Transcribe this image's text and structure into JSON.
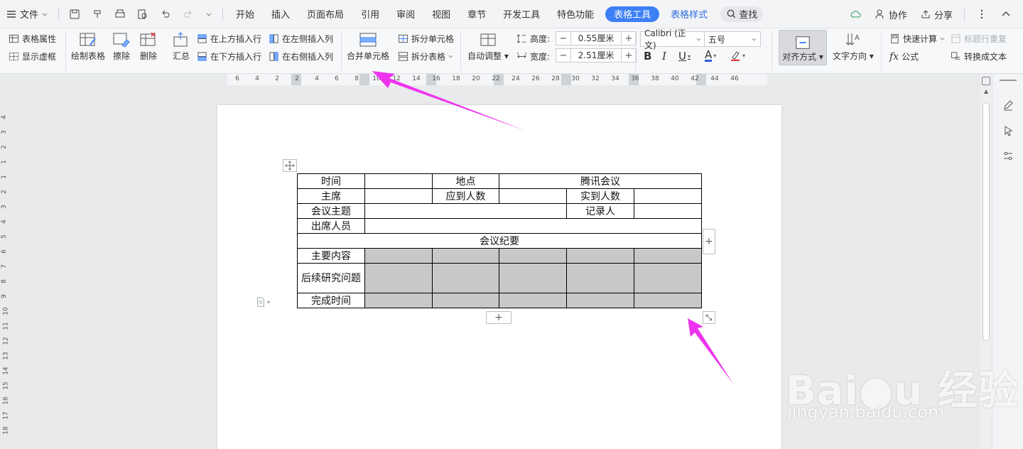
{
  "menubar": {
    "file_label": "文件",
    "tabs": [
      "开始",
      "插入",
      "页面布局",
      "引用",
      "审阅",
      "视图",
      "章节",
      "开发工具",
      "特色功能"
    ],
    "active_tab": "表格工具",
    "style_tab": "表格样式",
    "search_label": "查找",
    "collab_label": "协作",
    "share_label": "分享"
  },
  "ribbon": {
    "table_props": "表格属性",
    "show_grid": "显示虚框",
    "draw_table": "绘制表格",
    "erase": "擦除",
    "delete": "删除",
    "summary": "汇总",
    "insert_above": "在上方插入行",
    "insert_below": "在下方插入行",
    "insert_left": "在左侧插入列",
    "insert_right": "在右侧插入列",
    "merge_cells": "合并单元格",
    "split_cells": "拆分单元格",
    "split_table": "拆分表格",
    "auto_fit": "自动调整",
    "height_label": "高度:",
    "height_value": "0.55厘米",
    "width_label": "宽度:",
    "width_value": "2.51厘米",
    "font_name": "Calibri (正文)",
    "font_size": "五号",
    "align": "对齐方式",
    "text_dir": "文字方向",
    "quick_calc": "快速计算",
    "title_repeat": "标题行重复",
    "formula": "公式",
    "to_text": "转换成文本"
  },
  "ruler": {
    "h_ticks": [
      "6",
      "4",
      "2",
      "2",
      "4",
      "6",
      "8",
      "10",
      "12",
      "14",
      "16",
      "18",
      "20",
      "22",
      "24",
      "26",
      "28",
      "30",
      "32",
      "34",
      "36",
      "38",
      "40",
      "42",
      "44",
      "46"
    ],
    "v_ticks": [
      "4",
      "3",
      "2",
      "1",
      "1",
      "2",
      "3",
      "4",
      "5",
      "6",
      "7",
      "8",
      "9",
      "10",
      "11",
      "12",
      "13",
      "14",
      "15",
      "16",
      "17",
      "18"
    ]
  },
  "table": {
    "r1": [
      "时间",
      "",
      "地点",
      "腾讯会议"
    ],
    "r2": [
      "主席",
      "",
      "应到人数",
      "",
      "实到人数",
      ""
    ],
    "r3": [
      "会议主题",
      "",
      "记录人",
      ""
    ],
    "r4": [
      "出席人员",
      ""
    ],
    "r5": [
      "会议纪要"
    ],
    "r6_label": "主要内容",
    "r7_label": "后续研究问题",
    "r8_label": "完成时间"
  },
  "watermark": {
    "brand": "Bai",
    "brand2": "经验",
    "url": "jingyan.baidu.com"
  },
  "colors": {
    "accent": "#3d7ff5",
    "arrow": "#ee33ee",
    "selection": "#c8c8c8"
  }
}
